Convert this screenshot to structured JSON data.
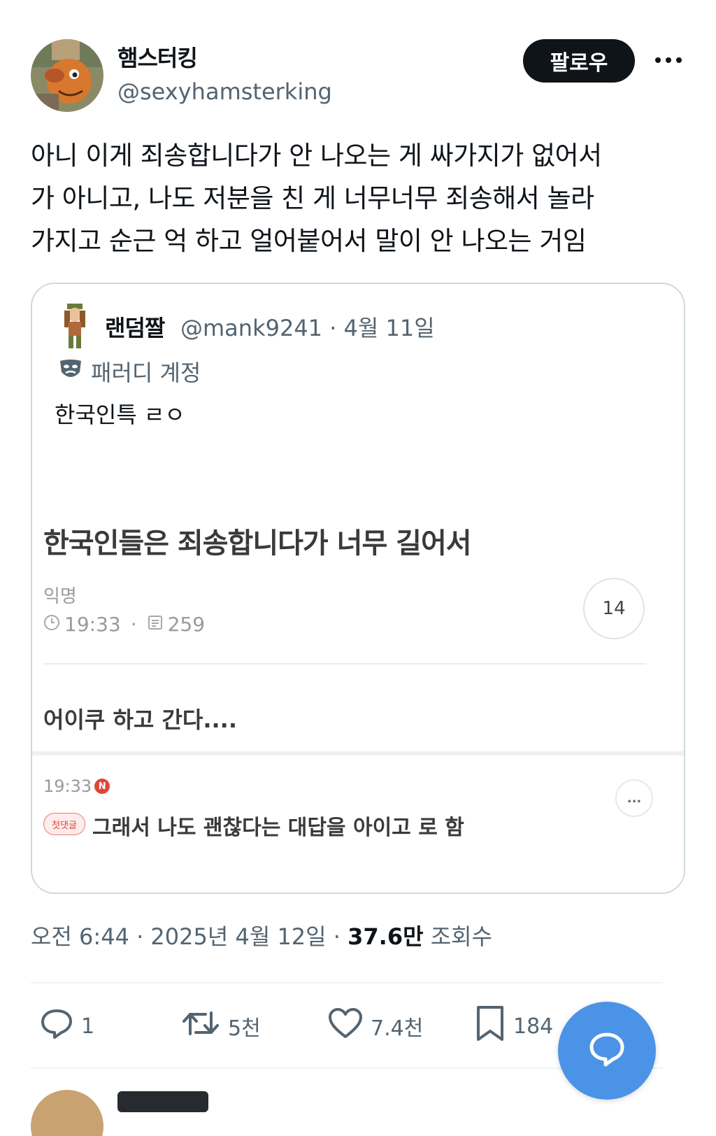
{
  "author": {
    "display_name": "햄스터킹",
    "handle": "@sexyhamsterking",
    "follow_label": "팔로우"
  },
  "tweet": {
    "lines": [
      "아니 이게 죄송합니다가 안 나오는 게 싸가지가 없어서",
      "가 아니고, 나도 저분을 친 게 너무너무 죄송해서 놀라",
      "가지고 순근 억 하고 얼어붙어서 말이 안 나오는 거임"
    ]
  },
  "quote": {
    "display_name": "랜덤짤",
    "meta": "@mank9241 · 4월 11일",
    "parody_label": "패러디 계정",
    "text": "한국인특 ㄹㅇ",
    "screenshot": {
      "title": "한국인들은 죄송합니다가 너무 길어서",
      "author": "익명",
      "time": "19:33",
      "views": "259",
      "comment_count": "14",
      "comment": "어이쿠 하고 간다....",
      "reply_time": "19:33",
      "reply_badge_letter": "N",
      "reply_more": "...",
      "first_reply_badge": "첫댓글",
      "reply_text": "그래서 나도 괜찮다는 대답을 아이고 로 함"
    }
  },
  "timestamp": {
    "prefix": "오전 6:44 · 2025년 4월 12일 · ",
    "views_count": "37.6만",
    "views_label": " 조회수"
  },
  "actions": {
    "replies": "1",
    "retweets": "5천",
    "likes": "7.4천",
    "bookmarks": "184"
  },
  "colors": {
    "primary_text": "#0f1419",
    "secondary_text": "#536471",
    "fab": "#4b93e6"
  },
  "icons": [
    "more-icon",
    "parody-mask-icon",
    "clock-icon",
    "views-icon",
    "reply-icon",
    "retweet-icon",
    "like-icon",
    "bookmark-icon",
    "new-message-icon"
  ]
}
